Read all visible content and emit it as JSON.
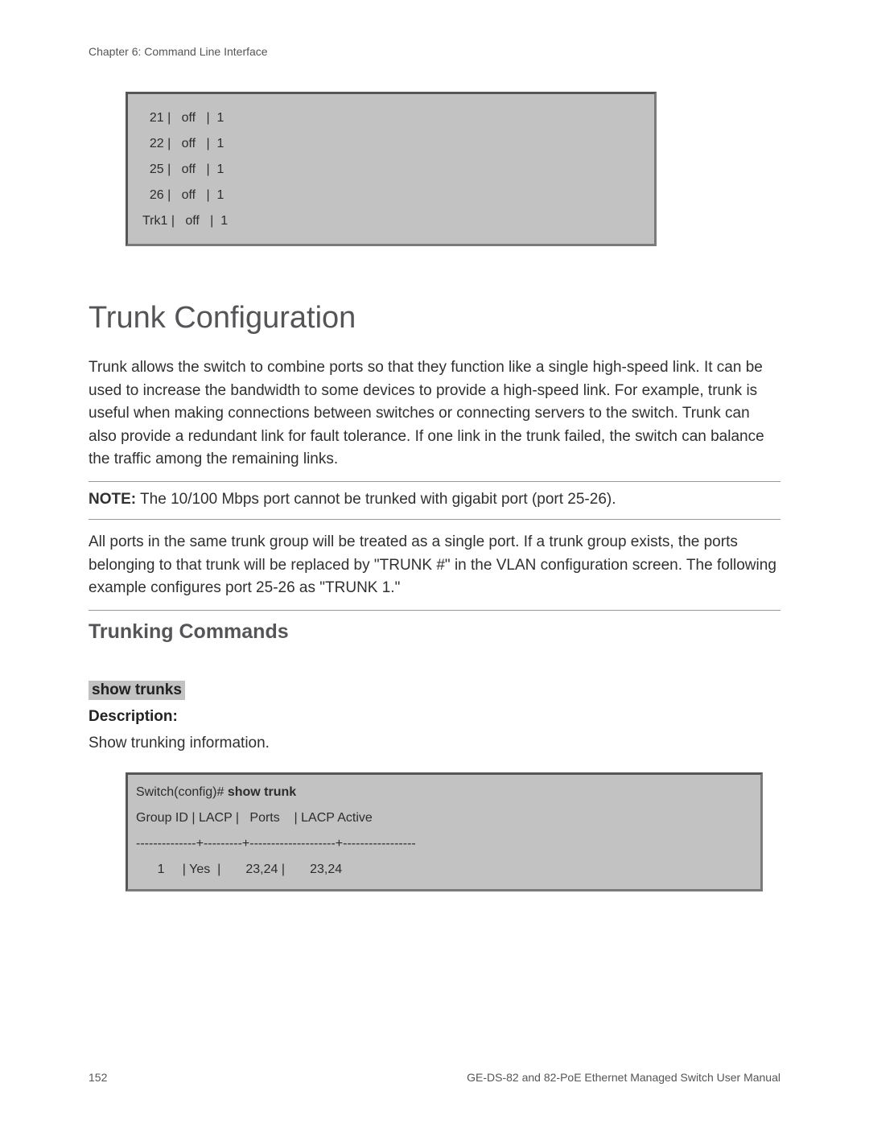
{
  "header": {
    "chapter": "Chapter 6: Command Line Interface"
  },
  "code1": {
    "lines": [
      "  21 |   off   |  1",
      "  22 |   off   |  1",
      "  25 |   off   |  1",
      "  26 |   off   |  1",
      "Trk1 |   off   |  1"
    ]
  },
  "section": {
    "title": "Trunk Configuration",
    "intro": "Trunk allows the switch to combine ports so that they function like a single high-speed link. It can be used to increase the bandwidth to some devices to provide a high-speed link. For example, trunk is useful when making connections between switches or connecting servers to the switch. Trunk can also provide a redundant link for fault tolerance. If one link in the trunk failed, the switch can balance the traffic among the remaining links.",
    "note_label": "NOTE:",
    "note_text": " The 10/100 Mbps port cannot be trunked with gigabit port (port 25-26).",
    "para2": "All ports in the same trunk group will be treated as a single port. If a trunk group exists, the ports belonging to that trunk will be replaced by \"TRUNK #\" in the VLAN configuration screen. The following example configures port 25-26 as \"TRUNK 1.\""
  },
  "subsection": {
    "title": "Trunking Commands",
    "command": "show trunks",
    "desc_label": "Description:",
    "desc_text": "Show trunking information."
  },
  "code2": {
    "prompt_prefix": "Switch(config)# ",
    "prompt_cmd": "show trunk",
    "header_line": "Group ID | LACP |   Ports    | LACP Active",
    "sep_line": "--------------+---------+--------------------+-----------------",
    "data_line": "      1     | Yes  |       23,24 |       23,24"
  },
  "footer": {
    "page": "152",
    "manual": "GE-DS-82 and 82-PoE Ethernet Managed Switch User Manual"
  }
}
